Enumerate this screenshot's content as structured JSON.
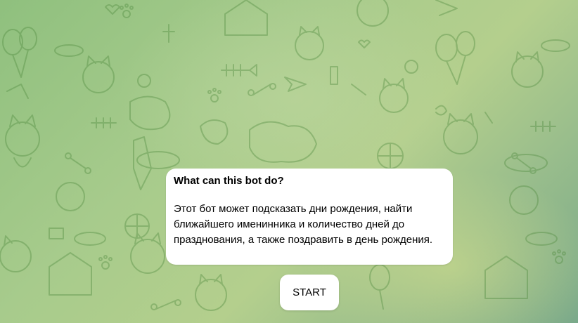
{
  "chat": {
    "background_pattern": "doodle-cats-pattern",
    "background_colors": [
      "#8fc07e",
      "#a7cb8c",
      "#b4cf8d",
      "#7aa98a"
    ]
  },
  "bot_info": {
    "title": "What can this bot do?",
    "description": "Этот бот может подсказать дни рождения, найти ближайшего именинника и количество дней до празднования, а также поздравить в день рождения."
  },
  "start_button": {
    "label": "START"
  }
}
